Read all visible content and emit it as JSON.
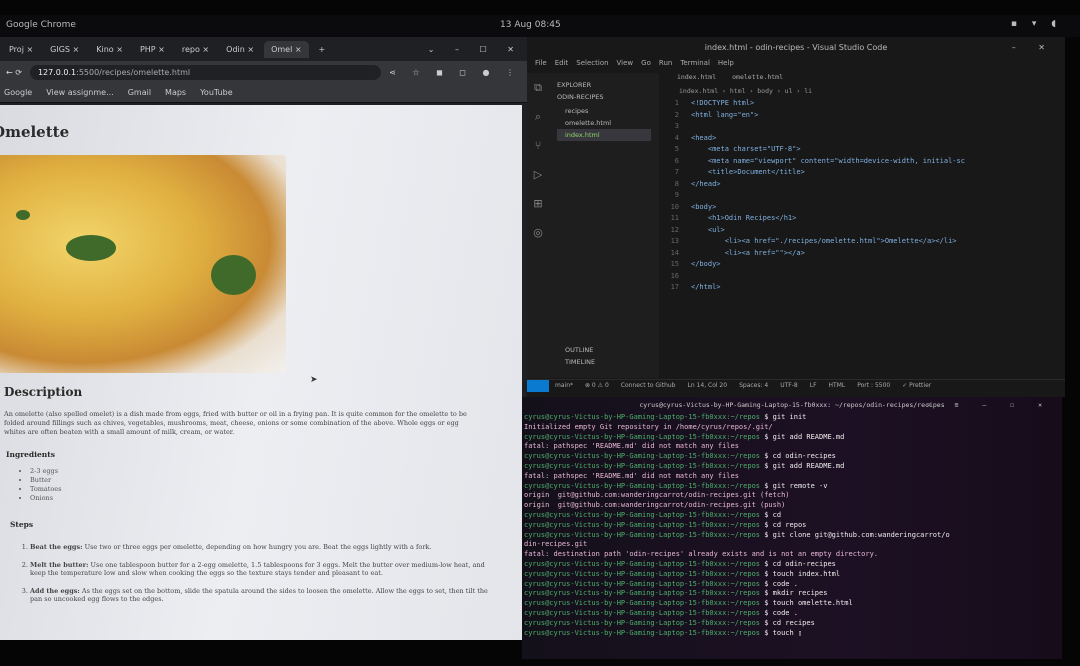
{
  "system_bar": {
    "app_name": "Google Chrome",
    "clock": "13 Aug 08:45",
    "tray": "▪ ▾ ◖"
  },
  "chrome": {
    "tabs": [
      {
        "label": "Proj"
      },
      {
        "label": "GIGS"
      },
      {
        "label": "Kino"
      },
      {
        "label": "PHP"
      },
      {
        "label": "repo"
      },
      {
        "label": "Odin"
      },
      {
        "label": "Omel",
        "active": true
      }
    ],
    "new_tab": "+",
    "window_controls": "⌄ – ☐ ✕",
    "url_host": "127.0.0.1",
    "url_path": ":5500/recipes/omelette.html",
    "toolbar_icons": "⋖ ☆ ◼ ◻ ● ⋮",
    "bookmarks": [
      "Google",
      "View assignme...",
      "Gmail",
      "Maps",
      "YouTube"
    ],
    "page": {
      "title": "Omelette",
      "description_heading": "Description",
      "description": "An omelette (also spelled omelet) is a dish made from eggs, fried with butter or oil in a frying pan. It is quite common for the omelette to be folded around fillings such as chives, vegetables, mushrooms, meat, cheese, onions or some combination of the above. Whole eggs or egg whites are often beaten with a small amount of milk, cream, or water.",
      "ingredients_heading": "Ingredients",
      "ingredients": [
        "2-3 eggs",
        "Butter",
        "Tomatoes",
        "Onions"
      ],
      "steps_heading": "Steps",
      "steps": [
        {
          "title": "Beat the eggs:",
          "text": "Use two or three eggs per omelette, depending on how hungry you are. Beat the eggs lightly with a fork."
        },
        {
          "title": "Melt the butter:",
          "text": "Use one tablespoon butter for a 2-egg omelette, 1.5 tablespoons for 3 eggs. Melt the butter over medium-low heat, and keep the temperature low and slow when cooking the eggs so the texture stays tender and pleasant to eat."
        },
        {
          "title": "Add the eggs:",
          "text": "As the eggs set on the bottom, slide the spatula around the sides to loosen the omelette. Allow the eggs to set, then tilt the pan so uncooked egg flows to the edges."
        }
      ]
    }
  },
  "vscode": {
    "title": "index.html - odin-recipes - Visual Studio Code",
    "window_controls": "– ✕",
    "menu": [
      "File",
      "Edit",
      "Selection",
      "View",
      "Go",
      "Run",
      "Terminal",
      "Help"
    ],
    "activity_icons": [
      "⧉",
      "⌕",
      "⑂",
      "▷",
      "⊞",
      "◎"
    ],
    "explorer": {
      "header": "EXPLORER",
      "project": "ODIN-RECIPES",
      "items": [
        {
          "label": "recipes"
        },
        {
          "label": "omelette.html"
        },
        {
          "label": "index.html",
          "selected": true
        }
      ],
      "outline": "OUTLINE",
      "timeline": "TIMELINE"
    },
    "editor_tabs": [
      "index.html",
      "omelette.html"
    ],
    "breadcrumb": "index.html › html › body › ul › li",
    "code": [
      "<!DOCTYPE html>",
      "<html lang=\"en\">",
      "",
      "<head>",
      "    <meta charset=\"UTF-8\">",
      "    <meta name=\"viewport\" content=\"width=device-width, initial-sc",
      "    <title>Document</title>",
      "</head>",
      "",
      "<body>",
      "    <h1>Odin Recipes</h1>",
      "    <ul>",
      "        <li><a href=\"./recipes/omelette.html\">Omelette</a></li>",
      "        <li><a href=\"\"></a>",
      "</body>",
      "",
      "</html>"
    ],
    "status": [
      "main*",
      "⊗ 0 ⚠ 0",
      "Connect to Github",
      "Ln 14, Col 20",
      "Spaces: 4",
      "UTF-8",
      "LF",
      "HTML",
      "Port : 5500",
      "✓ Prettier"
    ]
  },
  "terminal": {
    "title": "cyrus@cyrus-Victus-by-HP-Gaming-Laptop-15-fb0xxx: ~/repos/odin-recipes/recipes",
    "window_controls": "⌕ ≡ – ☐ ✕",
    "prompt": "cyrus@cyrus-Victus-by-HP-Gaming-Laptop-15-fb0xxx:~/repos",
    "lines": [
      {
        "type": "cmd",
        "text": "$ git init"
      },
      {
        "type": "out",
        "text": "Initialized empty Git repository in /home/cyrus/repos/.git/"
      },
      {
        "type": "cmd",
        "text": "$ git add README.md"
      },
      {
        "type": "out",
        "text": "fatal: pathspec 'README.md' did not match any files"
      },
      {
        "type": "cmd",
        "text": "$ cd odin-recipes"
      },
      {
        "type": "cmd",
        "text": "$ git add README.md"
      },
      {
        "type": "out",
        "text": "fatal: pathspec 'README.md' did not match any files"
      },
      {
        "type": "cmd",
        "text": "$ git remote -v"
      },
      {
        "type": "out",
        "text": "origin  git@github.com:wanderingcarrot/odin-recipes.git (fetch)"
      },
      {
        "type": "out",
        "text": "origin  git@github.com:wanderingcarrot/odin-recipes.git (push)"
      },
      {
        "type": "cmd",
        "text": "$ cd"
      },
      {
        "type": "cmd",
        "text": "$ cd repos"
      },
      {
        "type": "cmd",
        "text": "$ git clone git@github.com:wanderingcarrot/o"
      },
      {
        "type": "out",
        "text": "din-recipes.git"
      },
      {
        "type": "out",
        "text": "fatal: destination path 'odin-recipes' already exists and is not an empty directory."
      },
      {
        "type": "cmd",
        "text": "$ cd odin-recipes"
      },
      {
        "type": "cmd",
        "text": "$ touch index.html"
      },
      {
        "type": "cmd",
        "text": "$ code ."
      },
      {
        "type": "cmd",
        "text": "$ mkdir recipes"
      },
      {
        "type": "cmd",
        "text": "$ touch omelette.html"
      },
      {
        "type": "cmd",
        "text": "$ code ."
      },
      {
        "type": "cmd",
        "text": "$ cd recipes"
      },
      {
        "type": "cmd",
        "text": "$ touch ▯"
      }
    ]
  }
}
